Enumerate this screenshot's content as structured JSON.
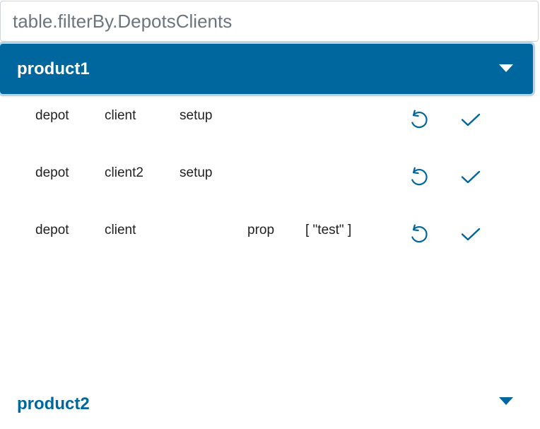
{
  "filter": {
    "placeholder": "table.filterBy.DepotsClients",
    "value": ""
  },
  "colors": {
    "primary": "#00679e",
    "header_text": "#ffffff",
    "row_text": "#222222"
  },
  "products": [
    {
      "name": "product1",
      "expanded": true,
      "rows": [
        {
          "depot": "depot",
          "client": "client",
          "method": "setup",
          "property": "",
          "value": ""
        },
        {
          "depot": "depot",
          "client": "client2",
          "method": "setup",
          "property": "",
          "value": ""
        },
        {
          "depot": "depot",
          "client": "client",
          "method": "",
          "property": "prop",
          "value": "[ \"test\" ]"
        }
      ]
    },
    {
      "name": "product2",
      "expanded": false,
      "rows": []
    }
  ],
  "icons": {
    "reset": "undo-icon",
    "accept": "check-icon",
    "expand": "caret-down-icon"
  }
}
